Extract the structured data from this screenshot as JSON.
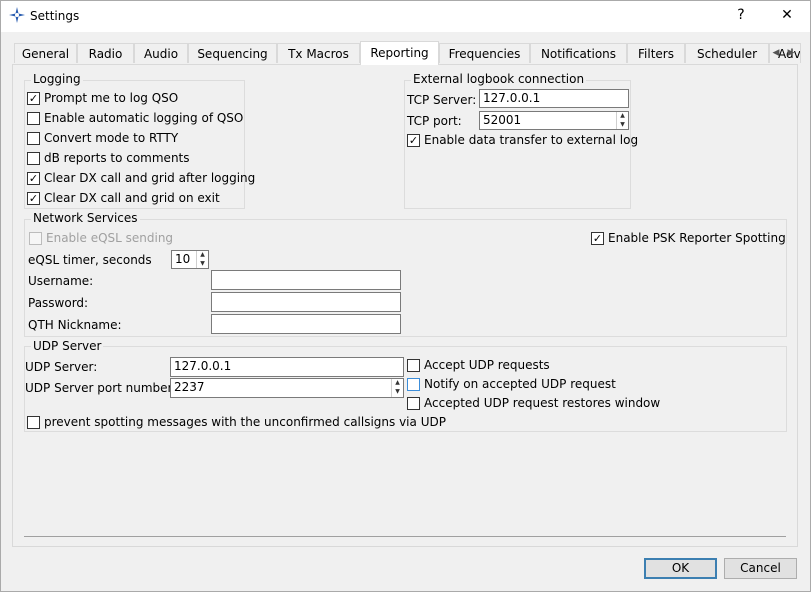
{
  "window": {
    "title": "Settings",
    "help_glyph": "?",
    "close_glyph": "✕"
  },
  "tabs": [
    "General",
    "Radio",
    "Audio",
    "Sequencing",
    "Tx Macros",
    "Reporting",
    "Frequencies",
    "Notifications",
    "Filters",
    "Scheduler",
    "Adv"
  ],
  "active_tab": "Reporting",
  "logging": {
    "legend": "Logging",
    "items": [
      {
        "label": "Prompt me to log QSO",
        "checked": true
      },
      {
        "label": "Enable automatic logging of QSO",
        "checked": false
      },
      {
        "label": "Convert mode to RTTY",
        "checked": false
      },
      {
        "label": "dB reports to comments",
        "checked": false
      },
      {
        "label": "Clear DX call and grid after logging",
        "checked": true
      },
      {
        "label": "Clear DX call and grid on exit",
        "checked": true
      }
    ]
  },
  "external_logbook": {
    "legend": "External logbook connection",
    "tcp_server_label": "TCP Server:",
    "tcp_server_value": "127.0.0.1",
    "tcp_port_label": "TCP port:",
    "tcp_port_value": "52001",
    "enable_label": "Enable data transfer to external log",
    "enable_checked": true
  },
  "network": {
    "legend": "Network Services",
    "eqsl_label": "Enable eQSL sending",
    "eqsl_checked": false,
    "psk_label": "Enable PSK Reporter Spotting",
    "psk_checked": true,
    "timer_label": "eQSL timer, seconds",
    "timer_value": "10",
    "username_label": "Username:",
    "username_value": "",
    "password_label": "Password:",
    "password_value": "",
    "qth_label": "QTH Nickname:",
    "qth_value": ""
  },
  "udp": {
    "legend": "UDP Server",
    "server_label": "UDP Server:",
    "server_value": "127.0.0.1",
    "port_label": "UDP Server port number:",
    "port_value": "2237",
    "options": [
      {
        "label": "Accept UDP requests",
        "checked": false
      },
      {
        "label": "Notify on accepted UDP request",
        "checked": false
      },
      {
        "label": "Accepted UDP request restores window",
        "checked": false
      }
    ],
    "prevent_label": "prevent spotting messages with the unconfirmed callsigns via UDP",
    "prevent_checked": false
  },
  "buttons": {
    "ok": "OK",
    "cancel": "Cancel"
  },
  "colors": {
    "focus_border": "#3c7fb1",
    "window_bg": "#f0f0f0"
  }
}
